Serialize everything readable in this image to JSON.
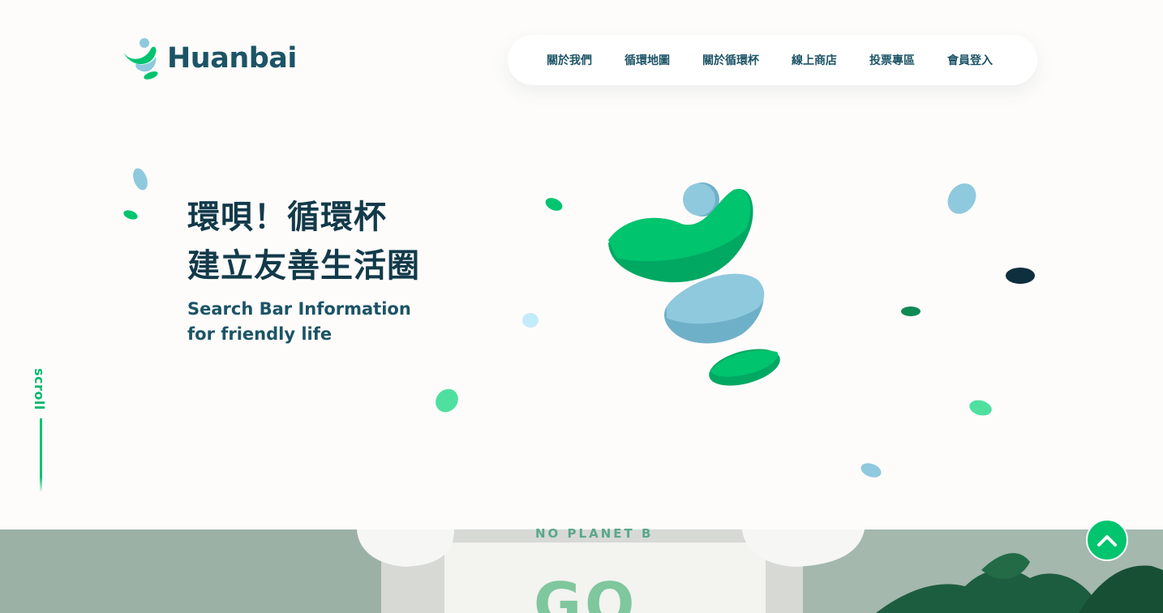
{
  "brand": {
    "name": "Huanbai",
    "icon": "huanbai-logo-icon",
    "colors": {
      "primary": "#00c46e",
      "dark": "#1c5466",
      "accent_blue": "#8fc9de"
    }
  },
  "nav": {
    "items": [
      {
        "label": "關於我們"
      },
      {
        "label": "循環地圖"
      },
      {
        "label": "關於循環杯"
      },
      {
        "label": "線上商店"
      },
      {
        "label": "投票專區"
      },
      {
        "label": "會員登入"
      }
    ]
  },
  "hero": {
    "title_line1": "環唄！循環杯",
    "title_line2": "建立友善生活圈",
    "subtitle_line1": "Search Bar Information",
    "subtitle_line2": "for friendly life"
  },
  "scroll": {
    "label": "scroll"
  },
  "banner": {
    "sign_text": "NO PLANET   B",
    "big_text": "GO"
  },
  "back_to_top": {
    "icon": "chevron-up-icon"
  }
}
